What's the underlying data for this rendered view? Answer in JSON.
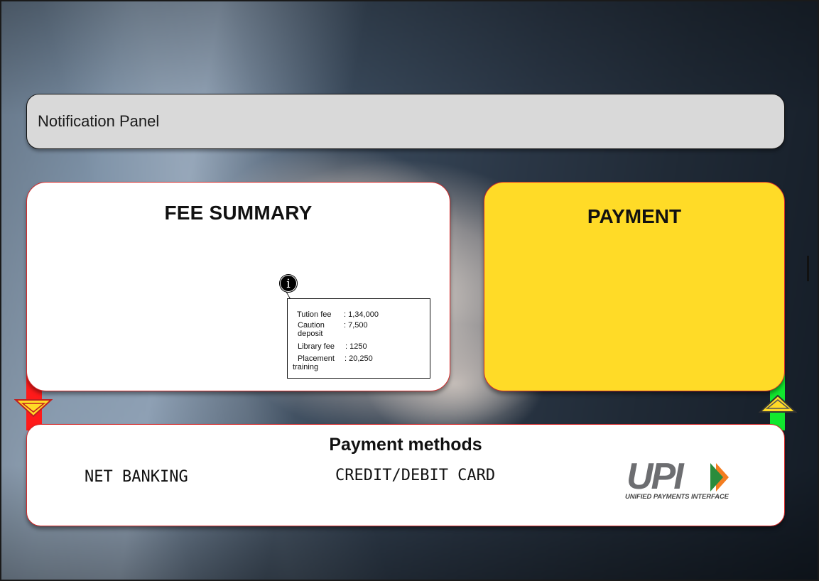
{
  "notification": {
    "label": "Notification Panel"
  },
  "fee_summary": {
    "title": "FEE SUMMARY",
    "info_icon_glyph": "i",
    "items": [
      {
        "label": "Tution fee",
        "value": ": 1,34,000"
      },
      {
        "label": "Caution",
        "label2": "deposit",
        "value": ": 7,500"
      },
      {
        "label": "Library fee",
        "value": ": 1250"
      },
      {
        "label": "Placement",
        "label2": "training",
        "value": ": 20,250"
      }
    ]
  },
  "payment": {
    "title": "PAYMENT",
    "background": "#ffdb27"
  },
  "payment_methods": {
    "title": "Payment methods",
    "net_banking": "NET BANKING",
    "card": "CREDIT/DEBIT CARD",
    "upi_logo_text": "UPI",
    "upi_tagline": "UNIFIED PAYMENTS INTERFACE"
  },
  "colors": {
    "accent_red": "#ff1a1a",
    "accent_green": "#11e72e",
    "arrow_yellow": "#ffdb27",
    "border_red": "#d42a2a"
  }
}
